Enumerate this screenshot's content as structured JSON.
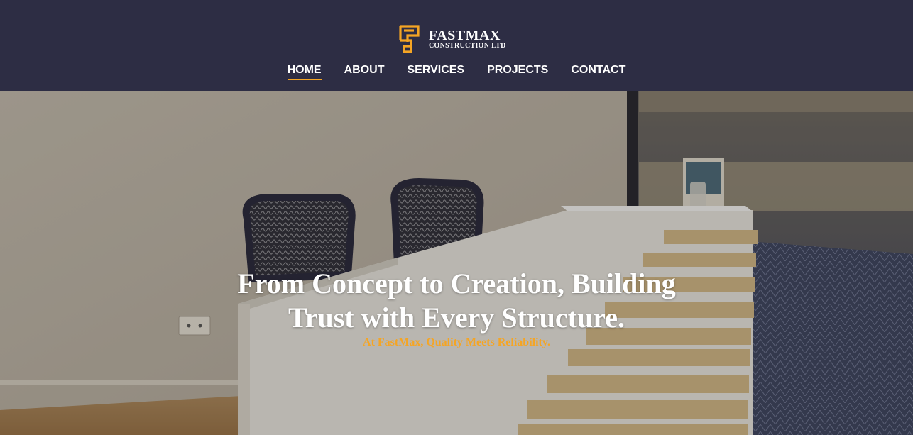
{
  "brand": {
    "name": "FASTMAX",
    "subtitle": "CONSTRUCTION LTD",
    "accent_color": "#f5a524",
    "header_color": "#2d2d44"
  },
  "nav": {
    "items": [
      {
        "label": "HOME",
        "active": true
      },
      {
        "label": "ABOUT",
        "active": false
      },
      {
        "label": "SERVICES",
        "active": false
      },
      {
        "label": "PROJECTS",
        "active": false
      },
      {
        "label": "CONTACT",
        "active": false
      }
    ]
  },
  "hero": {
    "headline_line1": "From Concept to Creation, Building",
    "headline_line2": "Trust with Every Structure.",
    "tagline": "At FastMax, Quality Meets Reliability.",
    "background_image": "office-reception-desk"
  }
}
